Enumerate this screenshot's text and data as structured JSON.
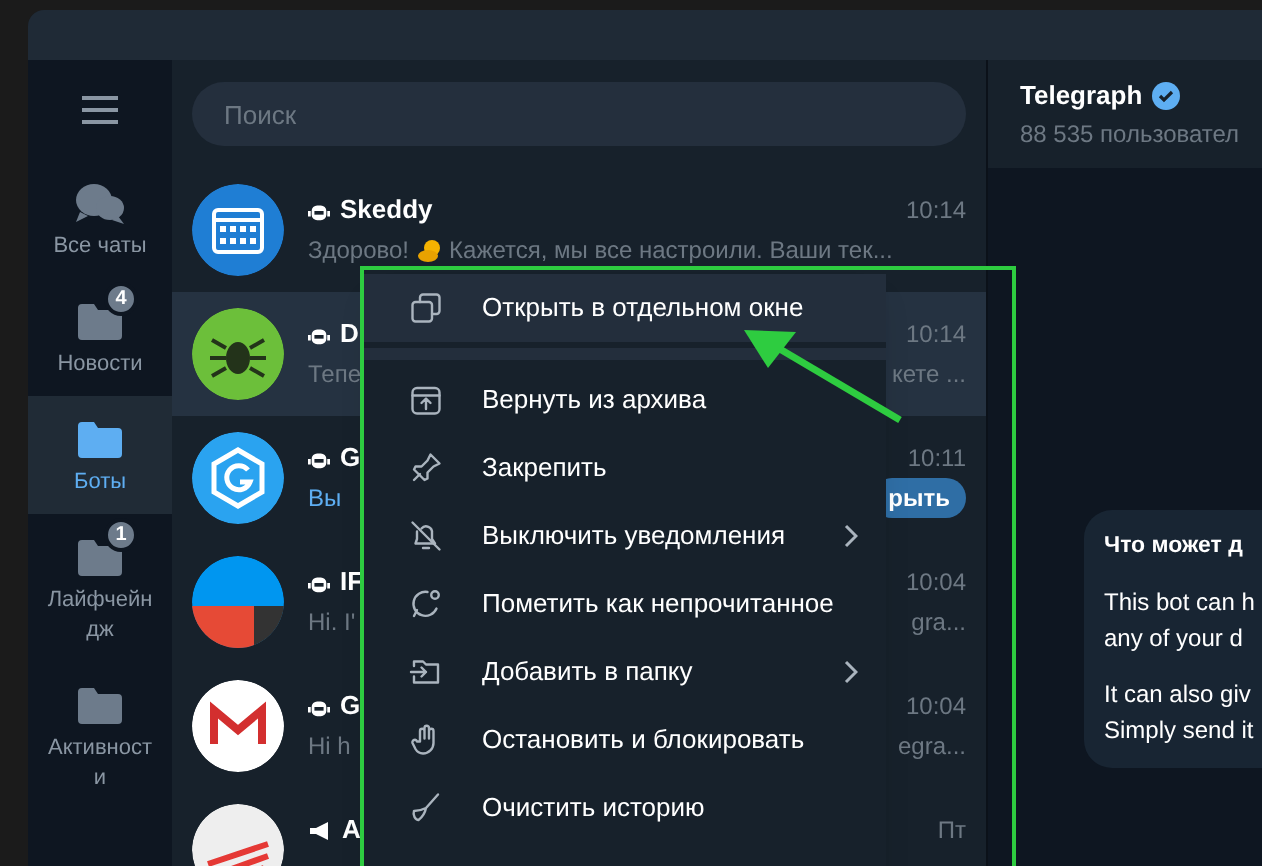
{
  "sidebar": {
    "items": [
      {
        "label": "Все чаты",
        "selected": false
      },
      {
        "label": "Новости",
        "badge": "4",
        "selected": false
      },
      {
        "label": "Боты",
        "selected": true
      },
      {
        "label": "Лайфчейндж",
        "badge": "1",
        "selected": false
      },
      {
        "label": "Активности",
        "selected": false
      }
    ]
  },
  "search": {
    "placeholder": "Поиск"
  },
  "chats": [
    {
      "kind": "bot",
      "name": "Skeddy",
      "time": "10:14",
      "preview": [
        "Здорово!",
        "Кажется, мы все настроили. Ваши тек..."
      ],
      "selected": false
    },
    {
      "kind": "bot",
      "name": "D",
      "time": "10:14",
      "preview": [
        "Тепе"
      ],
      "preview_tail": "кете ...",
      "selected": true
    },
    {
      "kind": "bot",
      "name": "G",
      "time": "10:11",
      "preview": [
        "Вы"
      ],
      "accent": true,
      "button": "рыть",
      "selected": false
    },
    {
      "kind": "bot",
      "name": "IF",
      "time": "10:04",
      "preview": [
        "Hi. I'"
      ],
      "preview_tail": "gra...",
      "selected": false
    },
    {
      "kind": "bot",
      "name": "G",
      "time": "10:04",
      "preview": [
        "Hi h"
      ],
      "preview_tail": "egra...",
      "selected": false
    },
    {
      "kind": "channel",
      "name": "A",
      "time": "Пт",
      "selected": false
    }
  ],
  "context_menu": {
    "items": [
      {
        "label": "Открыть в отдельном окне",
        "submenu": false,
        "selected": true
      },
      {
        "label": "Вернуть из архива",
        "submenu": false,
        "selected": false
      },
      {
        "label": "Закрепить",
        "submenu": false,
        "selected": false
      },
      {
        "label": "Выключить уведомления",
        "submenu": true,
        "selected": false
      },
      {
        "label": "Пометить как непрочитанное",
        "submenu": false,
        "selected": false
      },
      {
        "label": "Добавить в папку",
        "submenu": true,
        "selected": false
      },
      {
        "label": "Остановить и блокировать",
        "submenu": false,
        "selected": false
      },
      {
        "label": "Очистить историю",
        "submenu": false,
        "selected": false
      }
    ]
  },
  "chat_header": {
    "title": "Telegraph",
    "verified": true,
    "subtitle": "88 535 пользовател"
  },
  "bot_info": {
    "title": "Что может д",
    "paragraphs": [
      [
        "This bot can h",
        "any of your d"
      ],
      [
        "It can also giv",
        "Simply send it"
      ]
    ]
  }
}
